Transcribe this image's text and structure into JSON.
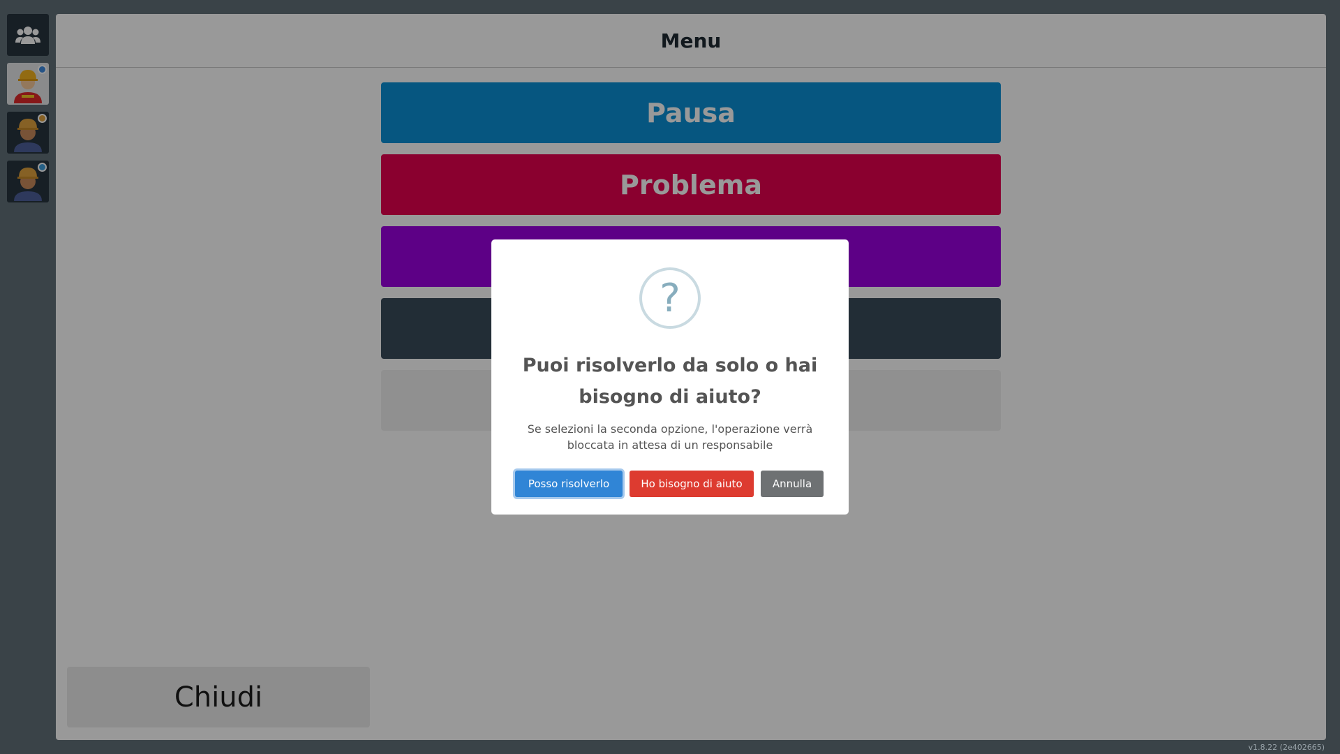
{
  "header": {
    "title": "Menu"
  },
  "sidebar": {
    "items": [
      {
        "icon": "users-icon"
      },
      {
        "icon": "worker-avatar-icon",
        "status_color": "#3f8ae0"
      },
      {
        "icon": "worker-avatar-icon",
        "status_color": "#e0a23f"
      },
      {
        "icon": "worker-avatar-icon",
        "status_color": "#3fa0e0"
      }
    ]
  },
  "menu": {
    "pause_label": "Pausa",
    "problem_label": "Problema",
    "close_label": "Chiudi"
  },
  "modal": {
    "icon": "question-icon",
    "title": "Puoi risolverlo da solo o hai bisogno di aiuto?",
    "text": "Se selezioni la seconda opzione, l'operazione verrà bloccata in attesa di un responsabile",
    "confirm_label": "Posso risolverlo",
    "help_label": "Ho bisogno di aiuto",
    "cancel_label": "Annulla"
  },
  "footer": {
    "version": "v1.8.22 (2e402665)"
  },
  "colors": {
    "pause": "#0a90d6",
    "problem": "#e6004f",
    "purple": "#9b00e0",
    "dark": "#3a4b5b"
  }
}
